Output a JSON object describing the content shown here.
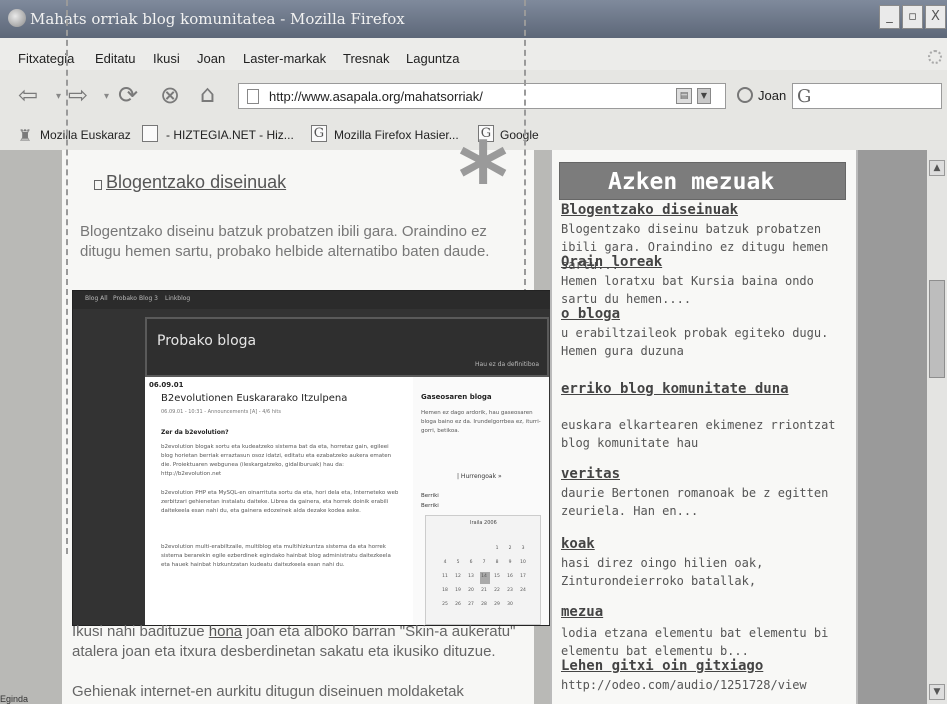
{
  "window": {
    "title": "Mahats orriak blog komunitatea - Mozilla Firefox",
    "minimize": "_",
    "maximize": "▫",
    "close": "X"
  },
  "menu": {
    "items": [
      "Fitxategia",
      "Editatu",
      "Ikusi",
      "Joan",
      "Laster-markak",
      "Tresnak",
      "Laguntza"
    ]
  },
  "nav": {
    "url": "http://www.asapala.org/mahatsorriak/",
    "go_label": "Joan",
    "search_icon": "G"
  },
  "bookmarks": {
    "items": [
      "Mozilla Euskaraz",
      "- HIZTEGIA.NET - Hiz...",
      "Mozilla Firefox Hasier...",
      "Google"
    ]
  },
  "post": {
    "title": "Blogentzako diseinuak",
    "body": "Blogentzako diseinu batzuk probatzen ibili gara. Oraindino ez ditugu hemen sartu, probako helbide alternatibo baten daude.",
    "body2_before": "Ikusi nahi badituzue ",
    "body2_link": "hona",
    "body2_after": " joan eta alboko barran \"Skin-a aukeratu\" atalera joan eta itxura desberdinetan sakatu eta ikusiko dituzue.",
    "body3": "Gehienak internet-en aurkitu ditugun diseinuen moldaketak"
  },
  "screenshot": {
    "nav": [
      "Blog All",
      "Probako",
      "Blog 3",
      "Linkblog"
    ],
    "blog_title": "Probako bloga",
    "subtitle": "Hau ez da definitiboa",
    "date": "06.09.01",
    "post_title": "B2evolutionen Euskararako Itzulpena",
    "meta": "06.09.01 - 10:31 - Announcements [A] - 4/6 hits",
    "heading": "Zer da b2evolution?",
    "para1": "b2evolution blogak sortu eta kudeatzeko sistema bat da eta, horretaz gain, egileei blog horietan berriak erraztasun osoz idatzi, editatu eta ezabatzeko aukera ematen die. Proiektuaren webgunea (ileskargatzeko, gidaliburuak) hau da: http://b2evolution.net",
    "para2": "b2evolution PHP eta MySQL-en oinarritutа sortu da eta, hori dela eta, Interneteko web zerbitzari gehienetan instalatu daiteke. Librea da gainera, eta horrek doinik erabili daitekeela esan nahi du, eta gainera edozeinek alda dezake kodea aske.",
    "para3": "b2evolution multi-erabiltzaile, multiblog eta multihizkuntza sistema da eta horrek sistema berarekin egile ezberdinek egindako hainbat blog administratu daitezkeela eta hauek hainbat hizkuntzatan kudeatu daitezkeela esan nahi du.",
    "side_title": "Gaseosaren bloga",
    "side_text": "Hemen ez dago ardorik, hau gaseosaren bloga baino ez da. Irundelgorrbea ez, iturri-gorri, betikoa.",
    "hurrengoak": "| Hurrengoak »",
    "side_links": [
      "Berriki",
      "Berriki"
    ],
    "calendar_title": "Iraila 2006",
    "calendar_rows": [
      [
        "",
        "",
        "",
        "",
        "1",
        "2",
        "3"
      ],
      [
        "4",
        "5",
        "6",
        "7",
        "8",
        "9",
        "10"
      ],
      [
        "11",
        "12",
        "13",
        "14",
        "15",
        "16",
        "17"
      ],
      [
        "18",
        "19",
        "20",
        "21",
        "22",
        "23",
        "24"
      ],
      [
        "25",
        "26",
        "27",
        "28",
        "29",
        "30",
        ""
      ]
    ]
  },
  "sidebar": {
    "title": "Azken mezuak",
    "items": [
      {
        "title": "Blogentzako diseinuak",
        "text": "Blogentzako diseinu batzuk probatzen ibili gara. Oraindino ez ditugu hemen sartu..."
      },
      {
        "title": "Orain loreak",
        "text": "Hemen loratxu bat Kursia baina ondo sartu du hemen...."
      },
      {
        "title": "o bloga",
        "text": "u erabiltzaileok probak egiteko dugu. Hemen gura duzuna"
      },
      {
        "title": "erriko blog komunitate duna",
        "text": "euskara elkartearen ekimenez rriontzat blog komunitate hau"
      },
      {
        "title": "veritas",
        "text": "daurie Bertonen romanoak be z egitten zeuriela. Han en..."
      },
      {
        "title": "koak",
        "text": "hasi direz oingo hilien oak, Zinturondeierroko batallak,"
      },
      {
        "title": "mezua",
        "text": "lodia etzana elementu bat elementu bi elementu bat elementu b..."
      },
      {
        "title": "Lehen gitxi oin gitxiago",
        "text": "http://odeo.com/audio/1251728/view"
      }
    ]
  },
  "status": "Eginda"
}
